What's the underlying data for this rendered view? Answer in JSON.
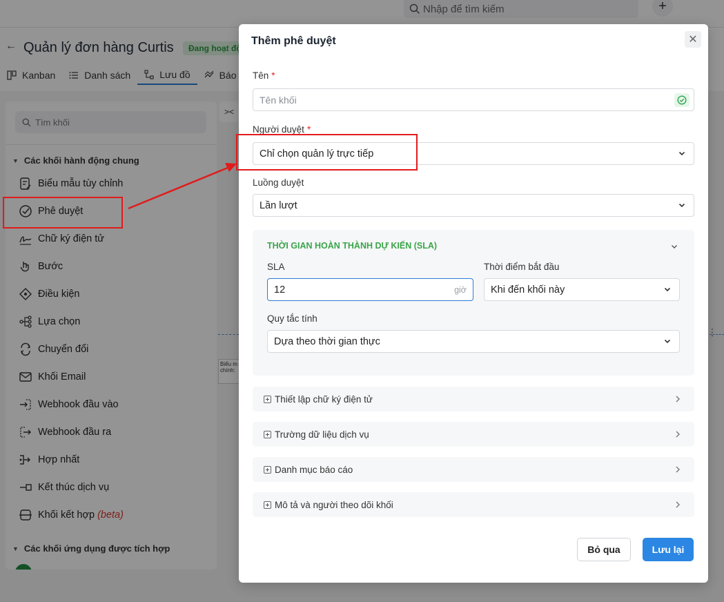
{
  "topbar": {
    "search_placeholder": "Nhập để tìm kiếm",
    "add_label": "+"
  },
  "header": {
    "title": "Quản lý đơn hàng Curtis",
    "status_badge": "Đang hoạt độ"
  },
  "tabs": [
    {
      "label": "Kanban",
      "icon": "kanban-icon"
    },
    {
      "label": "Danh sách",
      "icon": "list-icon"
    },
    {
      "label": "Lưu đồ",
      "icon": "flowchart-icon"
    },
    {
      "label": "Báo",
      "icon": "report-icon"
    }
  ],
  "sidebar": {
    "search_placeholder": "Tìm khối",
    "group1_title": "Các khối hành động chung",
    "items": [
      {
        "label": "Biểu mẫu tùy chỉnh",
        "icon": "form-icon"
      },
      {
        "label": "Phê duyệt",
        "icon": "check-circle-icon"
      },
      {
        "label": "Chữ ký điện tử",
        "icon": "signature-icon"
      },
      {
        "label": "Bước",
        "icon": "step-icon"
      },
      {
        "label": "Điều kiện",
        "icon": "condition-icon"
      },
      {
        "label": "Lựa chọn",
        "icon": "choice-icon"
      },
      {
        "label": "Chuyển đổi",
        "icon": "convert-icon"
      },
      {
        "label": "Khối Email",
        "icon": "email-icon"
      },
      {
        "label": "Webhook đầu vào",
        "icon": "webhook-in-icon"
      },
      {
        "label": "Webhook đầu ra",
        "icon": "webhook-out-icon"
      },
      {
        "label": "Hợp nhất",
        "icon": "merge-icon"
      },
      {
        "label": "Kết thúc dịch vụ",
        "icon": "end-icon"
      },
      {
        "label": "Khối kết hợp",
        "icon": "combine-icon",
        "suffix": "(beta)"
      }
    ],
    "group2_title": "Các khối ứng dụng được tích hợp"
  },
  "canvas": {
    "node_text": "Biểu m chính: "
  },
  "modal": {
    "title": "Thêm phê duyệt",
    "name_label": "Tên",
    "name_placeholder": "Tên khối",
    "approver_label": "Người duyệt",
    "approver_value": "Chỉ chọn quản lý trực tiếp",
    "flow_label": "Luồng duyệt",
    "flow_value": "Lần lượt",
    "required_mark": "*",
    "sla": {
      "title": "THỜI GIAN HOÀN THÀNH DỰ KIẾN (SLA)",
      "sla_label": "SLA",
      "sla_value": "12",
      "sla_unit": "giờ",
      "start_label": "Thời điểm bắt đầu",
      "start_value": "Khi đến khối này",
      "rule_label": "Quy tắc tính",
      "rule_value": "Dựa theo thời gian thực"
    },
    "sections": [
      "Thiết lập chữ ký điện tử",
      "Trường dữ liệu dịch vụ",
      "Danh mục báo cáo",
      "Mô tả và người theo dõi khối"
    ],
    "cancel_label": "Bỏ qua",
    "save_label": "Lưu lại"
  },
  "colors": {
    "primary": "#2b87e3",
    "sla_title": "#3aa54a",
    "annotation": "#e11b1b",
    "required": "#e02424"
  }
}
